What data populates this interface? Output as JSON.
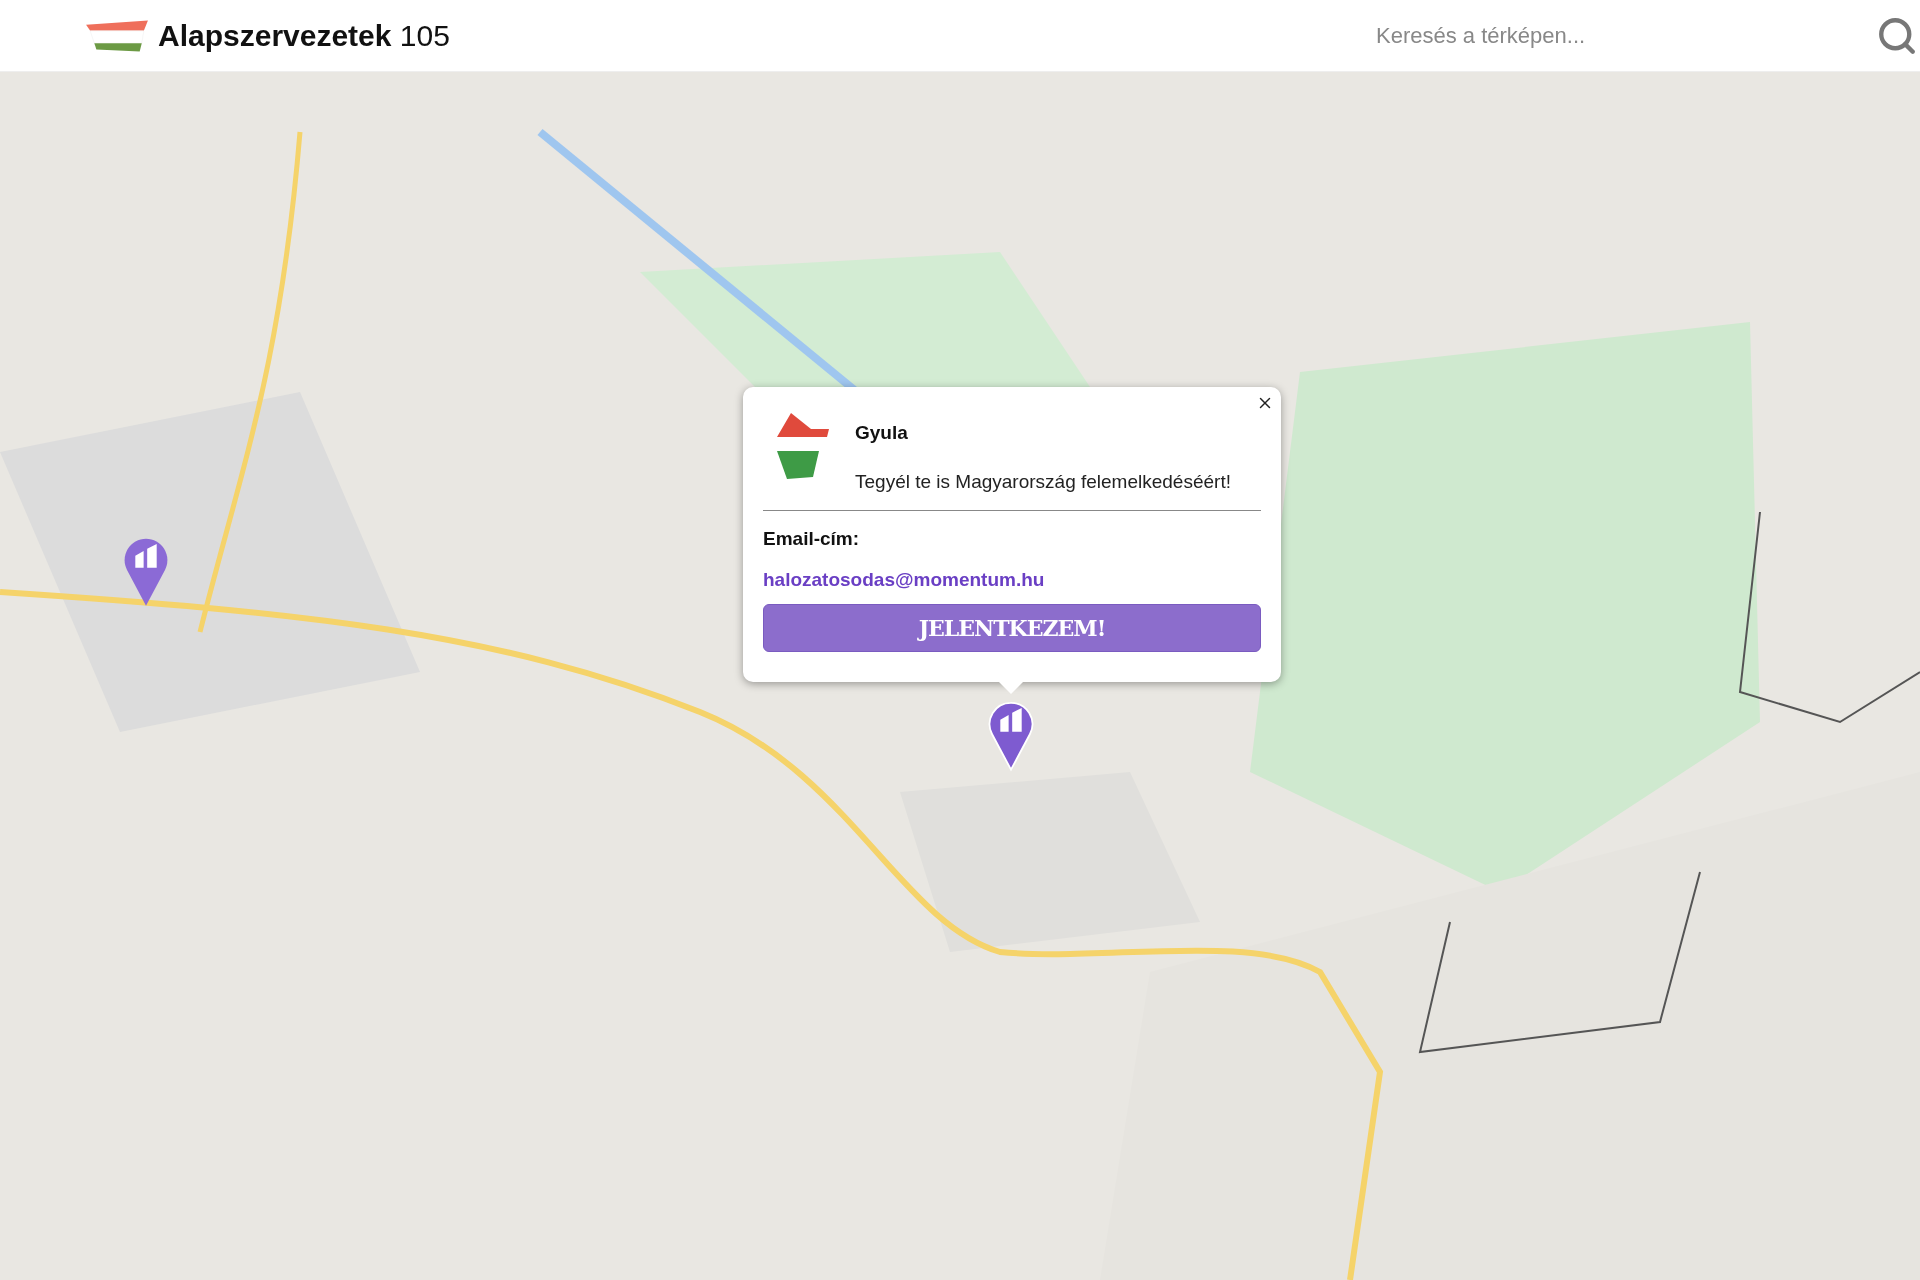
{
  "header": {
    "title": "Alapszervezetek",
    "count": "105"
  },
  "search": {
    "placeholder": "Keresés a térképen..."
  },
  "markers": [
    {
      "selected": false
    },
    {
      "selected": true
    }
  ],
  "popup": {
    "title": "Gyula",
    "slogan": "Tegyél te is Magyarország felemelkedéséért!",
    "email_label": "Email-cím:",
    "email": "halozatosodas@momentum.hu",
    "button": "JELENTKEZEM!"
  }
}
